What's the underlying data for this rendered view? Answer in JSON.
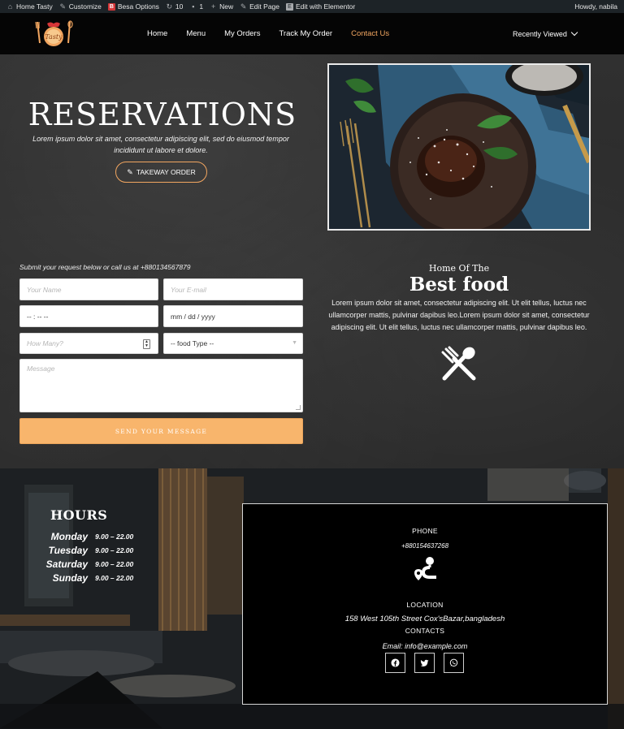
{
  "admin_bar": {
    "site_name": "Home Tasty",
    "customize": "Customize",
    "besa_options": "Besa Options",
    "updates_count": "10",
    "comments_count": "1",
    "new_label": "New",
    "edit_page": "Edit Page",
    "edit_elementor": "Edit with Elementor",
    "greeting": "Howdy, nabila"
  },
  "nav": {
    "items": [
      {
        "label": "Home"
      },
      {
        "label": "Menu"
      },
      {
        "label": "My Orders"
      },
      {
        "label": "Track My Order"
      },
      {
        "label": "Contact Us"
      }
    ],
    "active_color": "#f2a660",
    "recently_viewed": "Recently Viewed"
  },
  "hero": {
    "title": "RESERVATIONS",
    "description": "Lorem ipsum dolor sit amet, consectetur adipiscing elit, sed do eiusmod tempor incididunt ut labore et dolore.",
    "takeaway_button": "TAKEWAY ORDER"
  },
  "form": {
    "note": "Submit your request below or call us at +880134567879",
    "name_placeholder": "Your Name",
    "email_placeholder": "Your E-mail",
    "time_value": "-- : --  --",
    "date_value": "mm / dd / yyyy",
    "how_many_placeholder": "How Many?",
    "food_type_value": "-- food Type --",
    "message_placeholder": "Message",
    "send_button": "SEND YOUR MESSAGE",
    "button_color": "#f8b56c"
  },
  "about": {
    "kicker": "Home Of The",
    "heading": "Best food",
    "description": "Lorem ipsum dolor sit amet, consectetur adipiscing elit. Ut elit tellus, luctus nec ullamcorper mattis, pulvinar dapibus leo.Lorem ipsum dolor sit amet, consectetur adipiscing elit. Ut elit tellus, luctus nec ullamcorper mattis, pulvinar dapibus leo.",
    "icon": "fork-spoon-icon"
  },
  "hours": {
    "title": "HOURS",
    "rows": [
      {
        "day": "Monday",
        "time": "9.00 – 22.00"
      },
      {
        "day": "Tuesday",
        "time": "9.00 – 22.00"
      },
      {
        "day": "Saturday",
        "time": "9.00 – 22.00"
      },
      {
        "day": "Sunday",
        "time": "9.00 – 22.00"
      }
    ]
  },
  "contact": {
    "phone_label": "PHONE",
    "phone": "+880154637268",
    "location_label": "LOCATION",
    "address": "158 West 105th Street Cox'sBazar,bangladesh",
    "contacts_label": "CONTACTS",
    "email": "Email: info@example.com",
    "socials": [
      "facebook-icon",
      "twitter-icon",
      "whatsapp-icon"
    ]
  }
}
